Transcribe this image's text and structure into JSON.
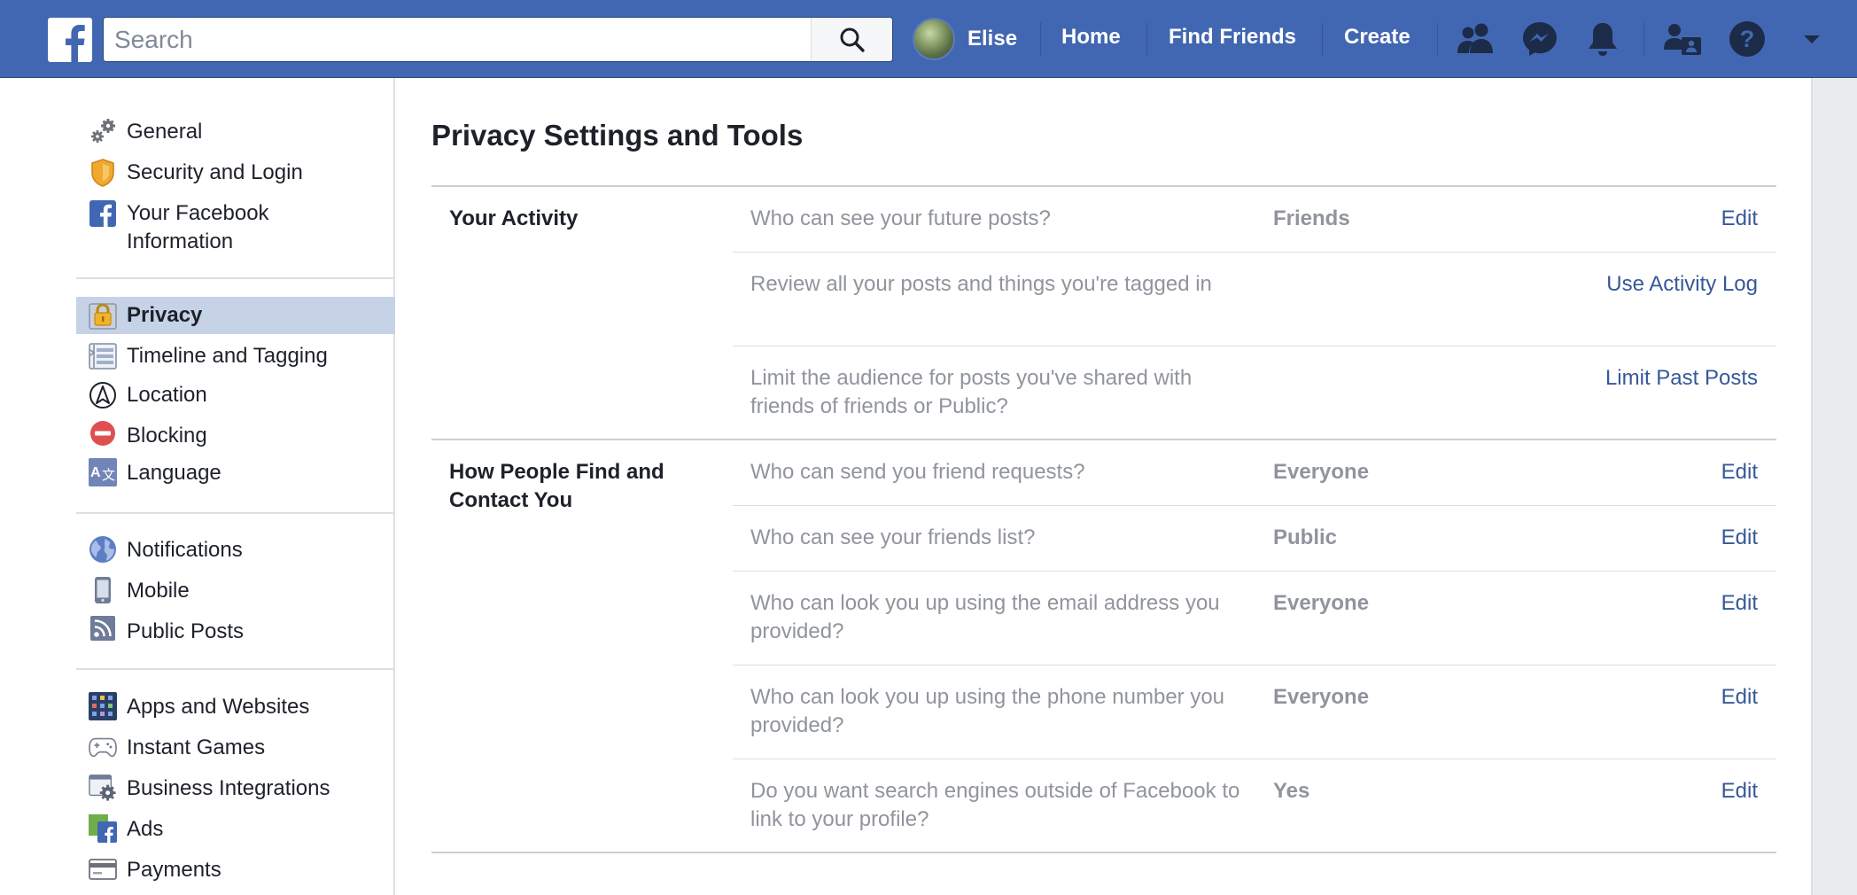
{
  "topbar": {
    "search_placeholder": "Search",
    "user_name": "Elise",
    "nav_links": [
      "Home",
      "Find Friends",
      "Create"
    ],
    "icons": [
      "friend-requests-icon",
      "messenger-icon",
      "notifications-bell-icon",
      "quick-help-icon",
      "help-icon",
      "account-menu-chevron-icon"
    ],
    "brand_color": "#4267b2"
  },
  "sidebar": {
    "groups": [
      [
        "General",
        "Security and Login",
        "Your Facebook Information"
      ],
      [
        "Privacy",
        "Timeline and Tagging",
        "Location",
        "Blocking",
        "Language"
      ],
      [
        "Notifications",
        "Mobile",
        "Public Posts"
      ],
      [
        "Apps and Websites",
        "Instant Games",
        "Business Integrations",
        "Ads",
        "Payments"
      ]
    ],
    "items": {
      "general": "General",
      "security": "Security and Login",
      "fb_info_1": "Your Facebook",
      "fb_info_2": "Information",
      "privacy": "Privacy",
      "timeline": "Timeline and Tagging",
      "location": "Location",
      "blocking": "Blocking",
      "language": "Language",
      "notifications": "Notifications",
      "mobile": "Mobile",
      "public_posts": "Public Posts",
      "apps": "Apps and Websites",
      "games": "Instant Games",
      "business": "Business Integrations",
      "ads": "Ads",
      "payments": "Payments"
    },
    "active_item": "Privacy",
    "active_color": "#c6d3e7"
  },
  "main": {
    "title": "Privacy Settings and Tools",
    "sections": {
      "activity": {
        "title": "Your Activity",
        "rows": {
          "future_posts": {
            "question": "Who can see your future posts?",
            "value": "Friends",
            "action": "Edit"
          },
          "review_posts": {
            "question": "Review all your posts and things you're tagged in",
            "action": "Use Activity Log"
          },
          "limit_audience": {
            "question": "Limit the audience for posts you've shared with friends of friends or Public?",
            "action": "Limit Past Posts"
          }
        }
      },
      "find_contact": {
        "title": "How People Find and Contact You",
        "rows": {
          "friend_requests": {
            "question": "Who can send you friend requests?",
            "value": "Everyone",
            "action": "Edit"
          },
          "friends_list": {
            "question": "Who can see your friends list?",
            "value": "Public",
            "action": "Edit"
          },
          "email_lookup": {
            "question": "Who can look you up using the email address you provided?",
            "value": "Everyone",
            "action": "Edit"
          },
          "phone_lookup": {
            "question": "Who can look you up using the phone number you provided?",
            "value": "Everyone",
            "action": "Edit"
          },
          "search_engines": {
            "question": "Do you want search engines outside of Facebook to link to your profile?",
            "value": "Yes",
            "action": "Edit"
          }
        }
      }
    },
    "link_color": "#365899",
    "muted_text_color": "#90949c"
  }
}
